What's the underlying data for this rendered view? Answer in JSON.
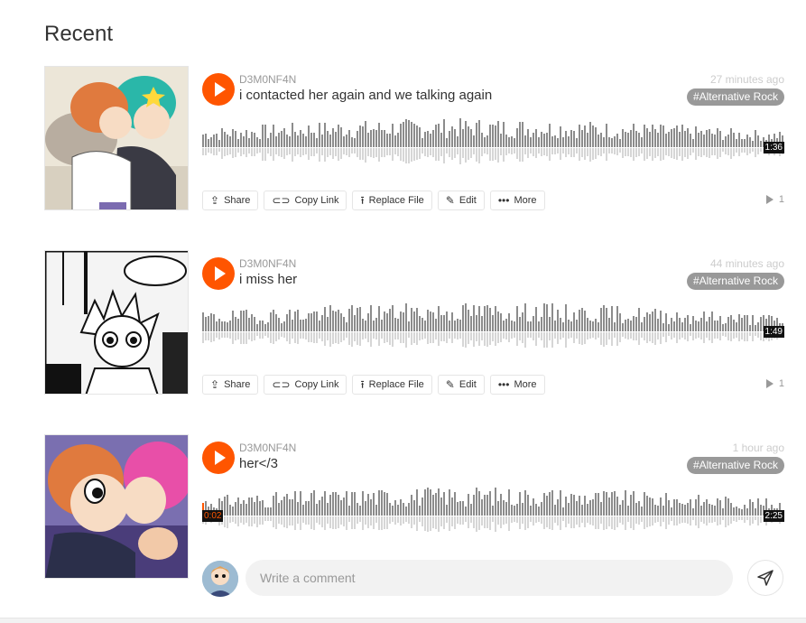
{
  "section": {
    "heading": "Recent"
  },
  "colors": {
    "accent": "#ff5500",
    "tag_bg": "#999999",
    "wave_bar": "#8c8c8c",
    "wave_reflection": "#d6d6d6"
  },
  "actions": {
    "share": "Share",
    "copy_link": "Copy Link",
    "replace_file": "Replace File",
    "edit": "Edit",
    "more": "More"
  },
  "tracks": [
    {
      "username": "D3M0NF4N",
      "title": "i contacted her again and we talking again",
      "posted": "27 minutes ago",
      "tag": "#Alternative Rock",
      "duration": "1:36",
      "plays": "1"
    },
    {
      "username": "D3M0NF4N",
      "title": "i miss her",
      "posted": "44 minutes ago",
      "tag": "#Alternative Rock",
      "duration": "1:49",
      "plays": "1"
    },
    {
      "username": "D3M0NF4N",
      "title": "her</3",
      "posted": "1 hour ago",
      "tag": "#Alternative Rock",
      "duration": "2:25",
      "elapsed": "0:02"
    }
  ],
  "comment": {
    "placeholder": "Write a comment"
  },
  "icons": {
    "share": "share-icon",
    "copy_link": "link-icon",
    "replace_file": "upload-icon",
    "edit": "pencil-icon",
    "more": "more-dots-icon",
    "play": "play-icon",
    "send": "send-icon"
  }
}
